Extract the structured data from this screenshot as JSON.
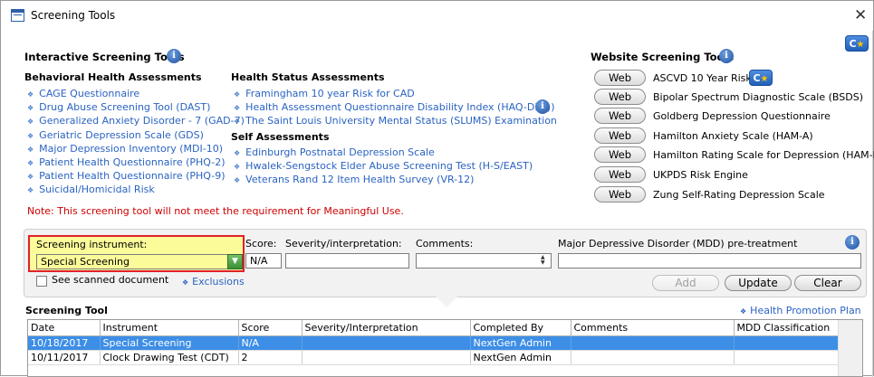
{
  "window": {
    "title": "Screening Tools"
  },
  "interactive": {
    "title": "Interactive Screening Tools",
    "behavioral": {
      "title": "Behavioral Health Assessments",
      "items": [
        "CAGE Questionnaire",
        "Drug Abuse Screening Tool (DAST)",
        "Generalized Anxiety Disorder - 7 (GAD-7)",
        "Geriatric Depression Scale (GDS)",
        "Major Depression Inventory (MDI-10)",
        "Patient Health Questionnaire (PHQ-2)",
        "Patient Health Questionnaire (PHQ-9)",
        "Suicidal/Homicidal Risk"
      ]
    },
    "health_status": {
      "title": "Health Status Assessments",
      "items": [
        "Framingham 10 year Risk for CAD",
        "Health Assessment Questionnaire Disability Index (HAQ-DI(c))",
        "The Saint Louis University Mental Status (SLUMS) Examination"
      ]
    },
    "self": {
      "title": "Self Assessments",
      "items": [
        "Edinburgh Postnatal Depression Scale",
        "Hwalek-Sengstock Elder Abuse Screening Test (H-S/EAST)",
        "Veterans Rand 12 Item Health Survey (VR-12)"
      ]
    },
    "note": "Note: This screening tool will not meet the requirement for Meaningful Use."
  },
  "website": {
    "title": "Website Screening Tools",
    "button_label": "Web",
    "items": [
      "ASCVD 10 Year Risk",
      "Bipolar Spectrum Diagnostic Scale (BSDS)",
      "Goldberg Depression Questionnaire",
      "Hamilton Anxiety Scale (HAM-A)",
      "Hamilton Rating Scale for Depression (HAM-D)",
      "UKPDS Risk Engine",
      "Zung Self-Rating Depression Scale"
    ]
  },
  "icons": {
    "info": "info-icon",
    "logo": "c-star-logo-icon",
    "close": "close-icon"
  },
  "entry": {
    "instrument_label": "Screening instrument:",
    "instrument_value": "Special Screening",
    "score_label": "Score:",
    "score_value": "N/A",
    "severity_label": "Severity/interpretation:",
    "comments_label": "Comments:",
    "mdd_label": "Major Depressive Disorder (MDD) pre-treatment",
    "scanned_label": "See scanned document",
    "exclusions_label": "Exclusions",
    "add_label": "Add",
    "update_label": "Update",
    "clear_label": "Clear"
  },
  "table": {
    "title": "Screening Tool",
    "health_link": "Health Promotion Plan",
    "columns": [
      "Date",
      "Instrument",
      "Score",
      "Severity/Interpretation",
      "Completed By",
      "Comments",
      "MDD Classification"
    ],
    "rows": [
      [
        "10/18/2017",
        "Special Screening",
        "N/A",
        "",
        "NextGen Admin",
        "",
        ""
      ],
      [
        "10/11/2017",
        "Clock Drawing Test (CDT)",
        "2",
        "",
        "NextGen Admin",
        "",
        ""
      ]
    ]
  },
  "colors": {
    "link": "#2a63c2",
    "note": "#d00000",
    "highlight": "#fbfb9a",
    "selected_row": "#3d8ee6"
  }
}
